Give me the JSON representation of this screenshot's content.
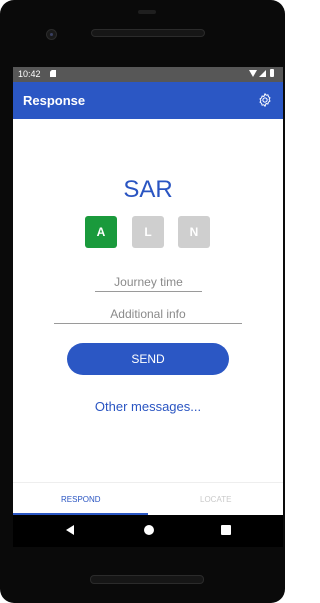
{
  "statusbar": {
    "time": "10:42",
    "icons": [
      "sd-card-icon",
      "wifi-icon",
      "signal-icon",
      "battery-icon"
    ]
  },
  "appbar": {
    "title": "Response",
    "settings_icon": "gear-icon"
  },
  "main": {
    "heading": "SAR",
    "toggles": [
      {
        "label": "A",
        "state": "selected",
        "color": "#1a9a3c"
      },
      {
        "label": "L",
        "state": "unselected",
        "color": "#cfcfcf"
      },
      {
        "label": "N",
        "state": "unselected",
        "color": "#cfcfcf"
      }
    ],
    "journey_time": {
      "placeholder": "Journey time",
      "value": ""
    },
    "additional_info": {
      "placeholder": "Additional info",
      "value": ""
    },
    "send_label": "SEND",
    "other_messages_label": "Other messages..."
  },
  "tabs": [
    {
      "label": "RESPOND",
      "active": true
    },
    {
      "label": "LOCATE",
      "active": false
    }
  ],
  "navbar": {
    "icons": [
      "back-icon",
      "home-icon",
      "recents-icon"
    ]
  },
  "colors": {
    "accent": "#2b57c4",
    "selected": "#1a9a3c",
    "unselected": "#cfcfcf"
  }
}
